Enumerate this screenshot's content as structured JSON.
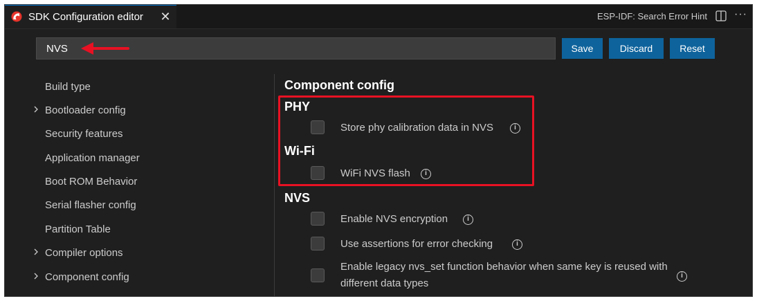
{
  "tab": {
    "title": "SDK Configuration editor",
    "close": "✕"
  },
  "header_action": "ESP-IDF: Search Error Hint",
  "more": "···",
  "search": {
    "value": "NVS"
  },
  "buttons": {
    "save": "Save",
    "discard": "Discard",
    "reset": "Reset"
  },
  "sidebar": {
    "items": [
      {
        "label": "Build type",
        "expandable": false
      },
      {
        "label": "Bootloader config",
        "expandable": true
      },
      {
        "label": "Security features",
        "expandable": false
      },
      {
        "label": "Application manager",
        "expandable": false
      },
      {
        "label": "Boot ROM Behavior",
        "expandable": false
      },
      {
        "label": "Serial flasher config",
        "expandable": false
      },
      {
        "label": "Partition Table",
        "expandable": false
      },
      {
        "label": "Compiler options",
        "expandable": true
      },
      {
        "label": "Component config",
        "expandable": true
      }
    ]
  },
  "content": {
    "title": "Component config",
    "sections": [
      {
        "title": "PHY",
        "options": [
          {
            "label": "Store phy calibration data in NVS",
            "checked": false
          }
        ]
      },
      {
        "title": "Wi-Fi",
        "options": [
          {
            "label": "WiFi NVS flash",
            "checked": false
          }
        ]
      },
      {
        "title": "NVS",
        "options": [
          {
            "label": "Enable NVS encryption",
            "checked": false
          },
          {
            "label": "Use assertions for error checking",
            "checked": false
          },
          {
            "label": "Enable legacy nvs_set function behavior when same key is reused with different data types",
            "checked": false
          }
        ]
      }
    ]
  },
  "colors": {
    "accent": "#0e639c",
    "highlight": "#e81123",
    "background": "#1f1f1f"
  },
  "info_glyph": "i"
}
